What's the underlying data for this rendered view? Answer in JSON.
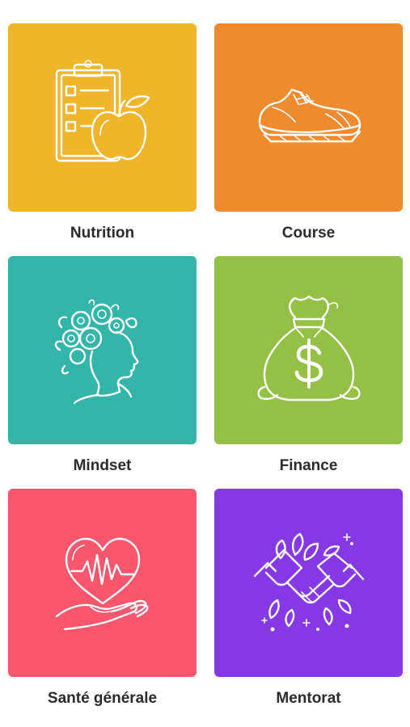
{
  "categories": [
    {
      "label": "Nutrition",
      "color": "#F0B62B",
      "icon": "clipboard-apple-icon"
    },
    {
      "label": "Course",
      "color": "#EF8A2E",
      "icon": "running-shoe-icon"
    },
    {
      "label": "Mindset",
      "color": "#33B5A7",
      "icon": "flower-head-icon"
    },
    {
      "label": "Finance",
      "color": "#96BF45",
      "icon": "money-bag-icon"
    },
    {
      "label": "Santé générale",
      "color": "#F7566B",
      "icon": "heart-hand-icon"
    },
    {
      "label": "Mentorat",
      "color": "#8538E3",
      "icon": "handshake-icon"
    }
  ]
}
